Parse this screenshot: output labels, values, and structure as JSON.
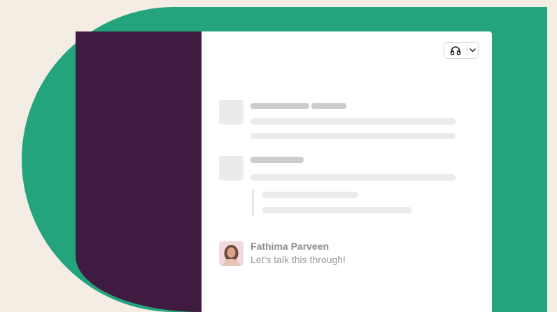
{
  "colors": {
    "background": "#f4ede4",
    "green_shape": "#24a47d",
    "sidebar": "#3f1b42",
    "main_pane": "#ffffff",
    "skeleton_dark": "#cdcdcd",
    "skeleton_light": "#ebebeb",
    "sender_text": "#8a8a8a",
    "message_text": "#9a9a9a"
  },
  "header": {
    "huddle_icon": "headphones-icon",
    "dropdown_icon": "chevron-down-icon"
  },
  "messages": [
    {
      "type": "placeholder"
    },
    {
      "type": "placeholder-with-quote"
    },
    {
      "type": "real",
      "avatar_icon": "user-avatar",
      "sender": "Fathima Parveen",
      "text": "Let’s talk this through!"
    }
  ]
}
